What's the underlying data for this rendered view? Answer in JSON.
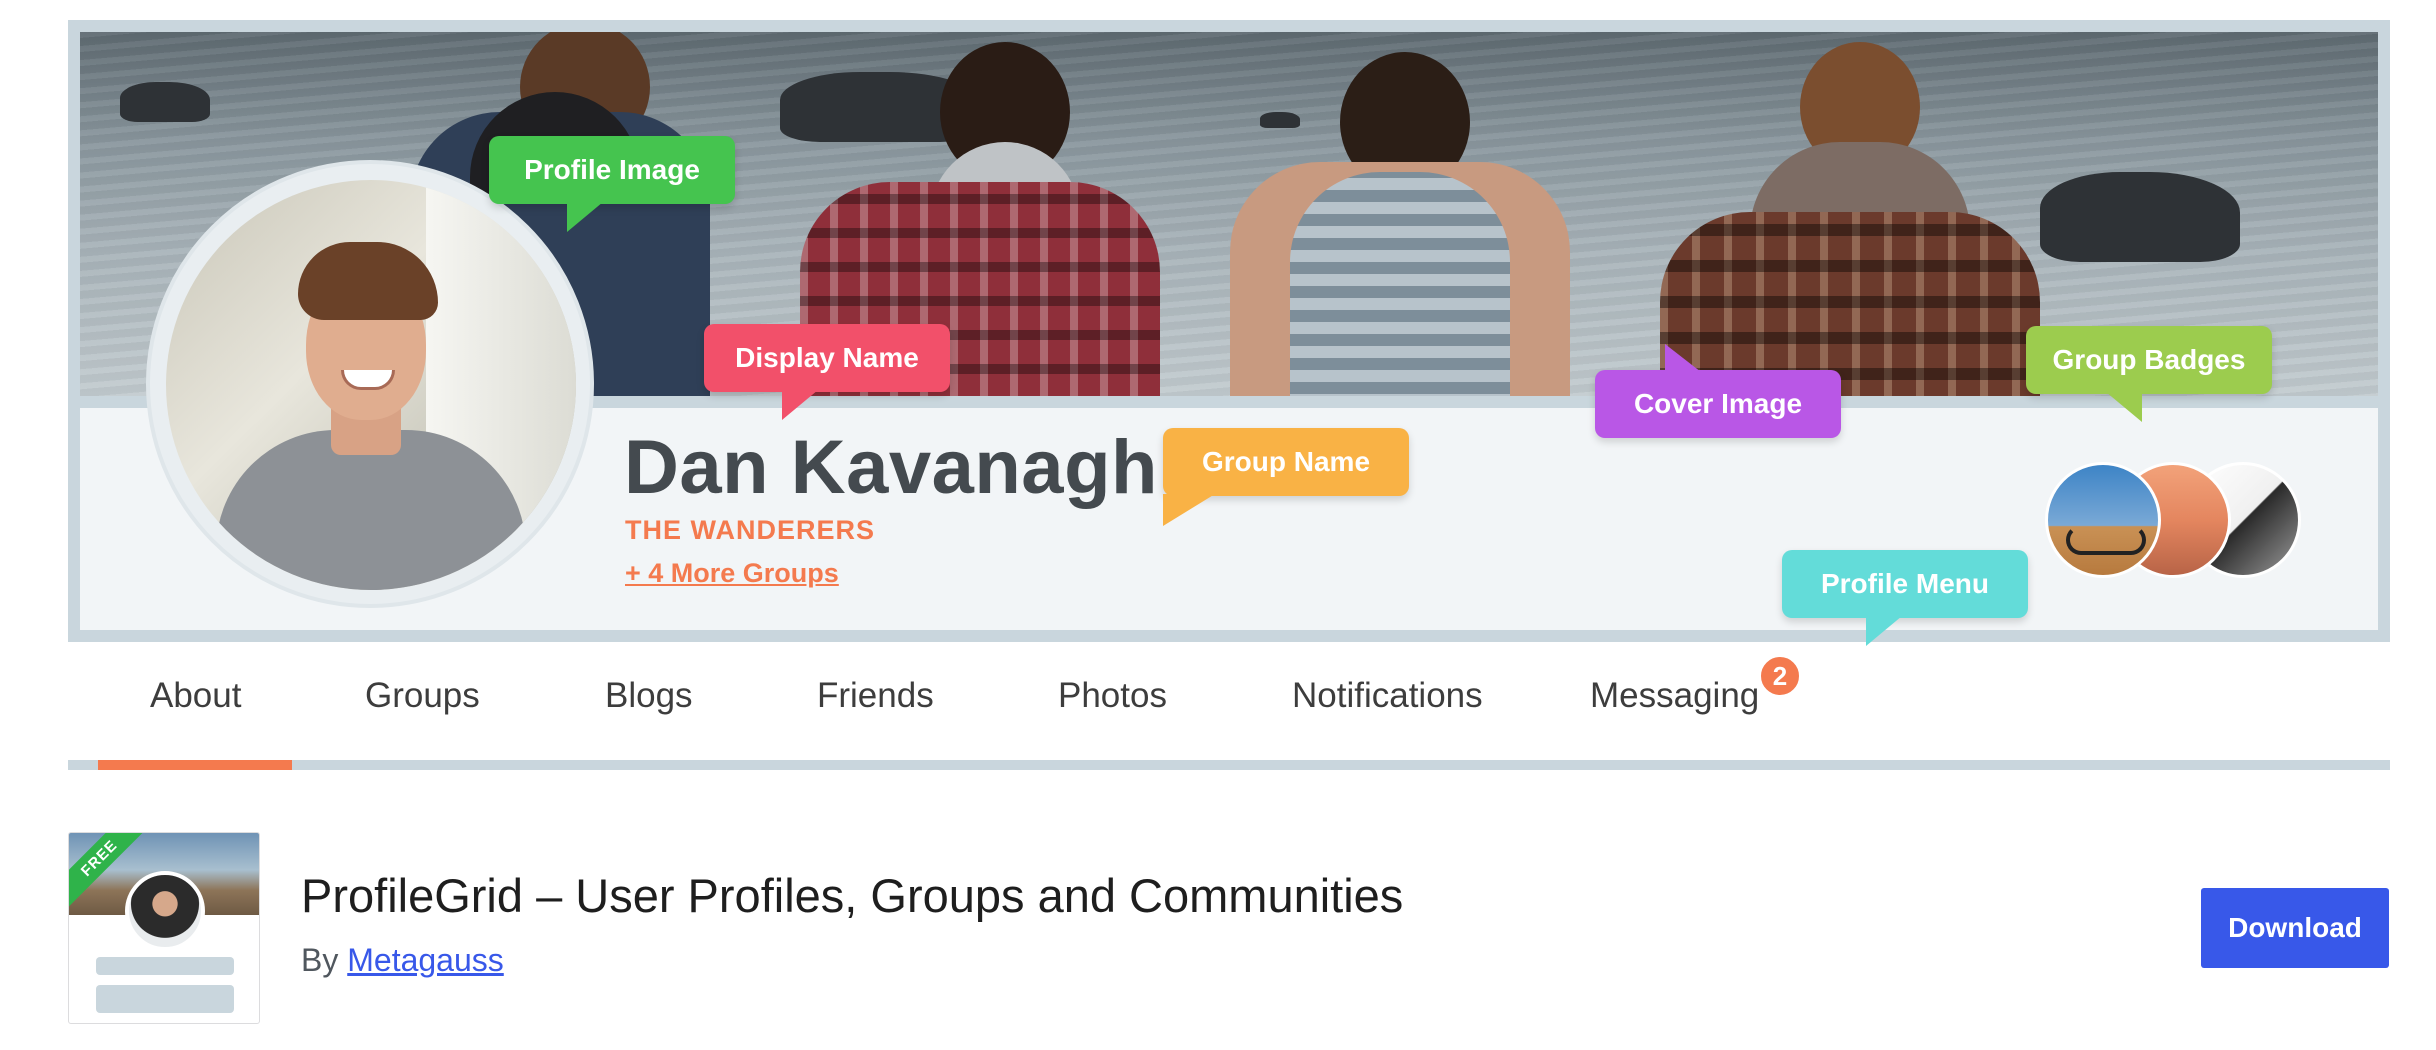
{
  "banner": {
    "display_name": "Dan Kavanagh",
    "group_name": "THE WANDERERS",
    "more_groups": "+ 4 More Groups",
    "tooltips": {
      "profile_image": "Profile Image",
      "display_name": "Display Name",
      "group_name": "Group Name",
      "cover_image": "Cover Image",
      "group_badges": "Group Badges",
      "profile_menu": "Profile Menu"
    },
    "colors": {
      "accent": "#f47a4e",
      "profile_image_tip": "#45c44f",
      "display_name_tip": "#f2506a",
      "group_name_tip": "#f9b245",
      "cover_image_tip": "#b957e6",
      "group_badges_tip": "#9ccc4e",
      "profile_menu_tip": "#63dcd9"
    }
  },
  "tabs": {
    "items": [
      {
        "label": "About",
        "active": true
      },
      {
        "label": "Groups"
      },
      {
        "label": "Blogs"
      },
      {
        "label": "Friends"
      },
      {
        "label": "Photos"
      },
      {
        "label": "Notifications"
      },
      {
        "label": "Messaging"
      }
    ],
    "messaging_count": "2"
  },
  "plugin": {
    "ribbon": "FREE",
    "title": "ProfileGrid – User Profiles, Groups and Communities",
    "by_label": "By",
    "author": "Metagauss",
    "download_label": "Download",
    "button_color": "#3858e9"
  }
}
